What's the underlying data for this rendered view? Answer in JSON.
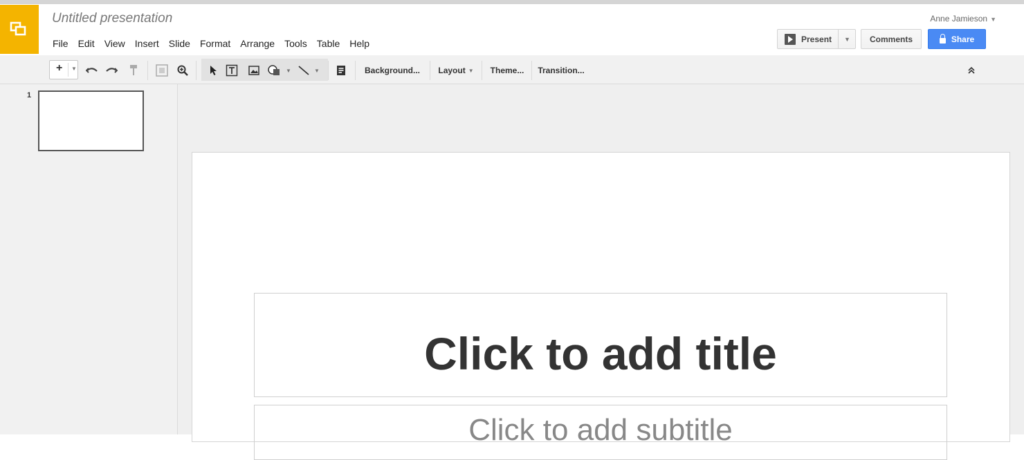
{
  "app": {
    "document_title": "Untitled presentation",
    "user_name": "Anne Jamieson",
    "brand_color": "#f4b400",
    "accent_color": "#4a8af4"
  },
  "menu": [
    "File",
    "Edit",
    "View",
    "Insert",
    "Slide",
    "Format",
    "Arrange",
    "Tools",
    "Table",
    "Help"
  ],
  "header_buttons": {
    "present_label": "Present",
    "comments_label": "Comments",
    "share_label": "Share"
  },
  "toolbar": {
    "add_icon": "plus-icon",
    "icons": [
      "undo-icon",
      "redo-icon",
      "paint-format-icon",
      "zoom-fit-icon",
      "zoom-icon",
      "select-icon",
      "textbox-icon",
      "image-icon",
      "shape-icon",
      "line-icon",
      "speaker-notes-icon",
      "collapse-icon"
    ],
    "background_label": "Background...",
    "layout_label": "Layout",
    "theme_label": "Theme...",
    "transition_label": "Transition..."
  },
  "filmstrip": {
    "slides": [
      {
        "number": "1"
      }
    ]
  },
  "slide": {
    "title_placeholder": "Click to add title",
    "subtitle_placeholder": "Click to add subtitle"
  }
}
